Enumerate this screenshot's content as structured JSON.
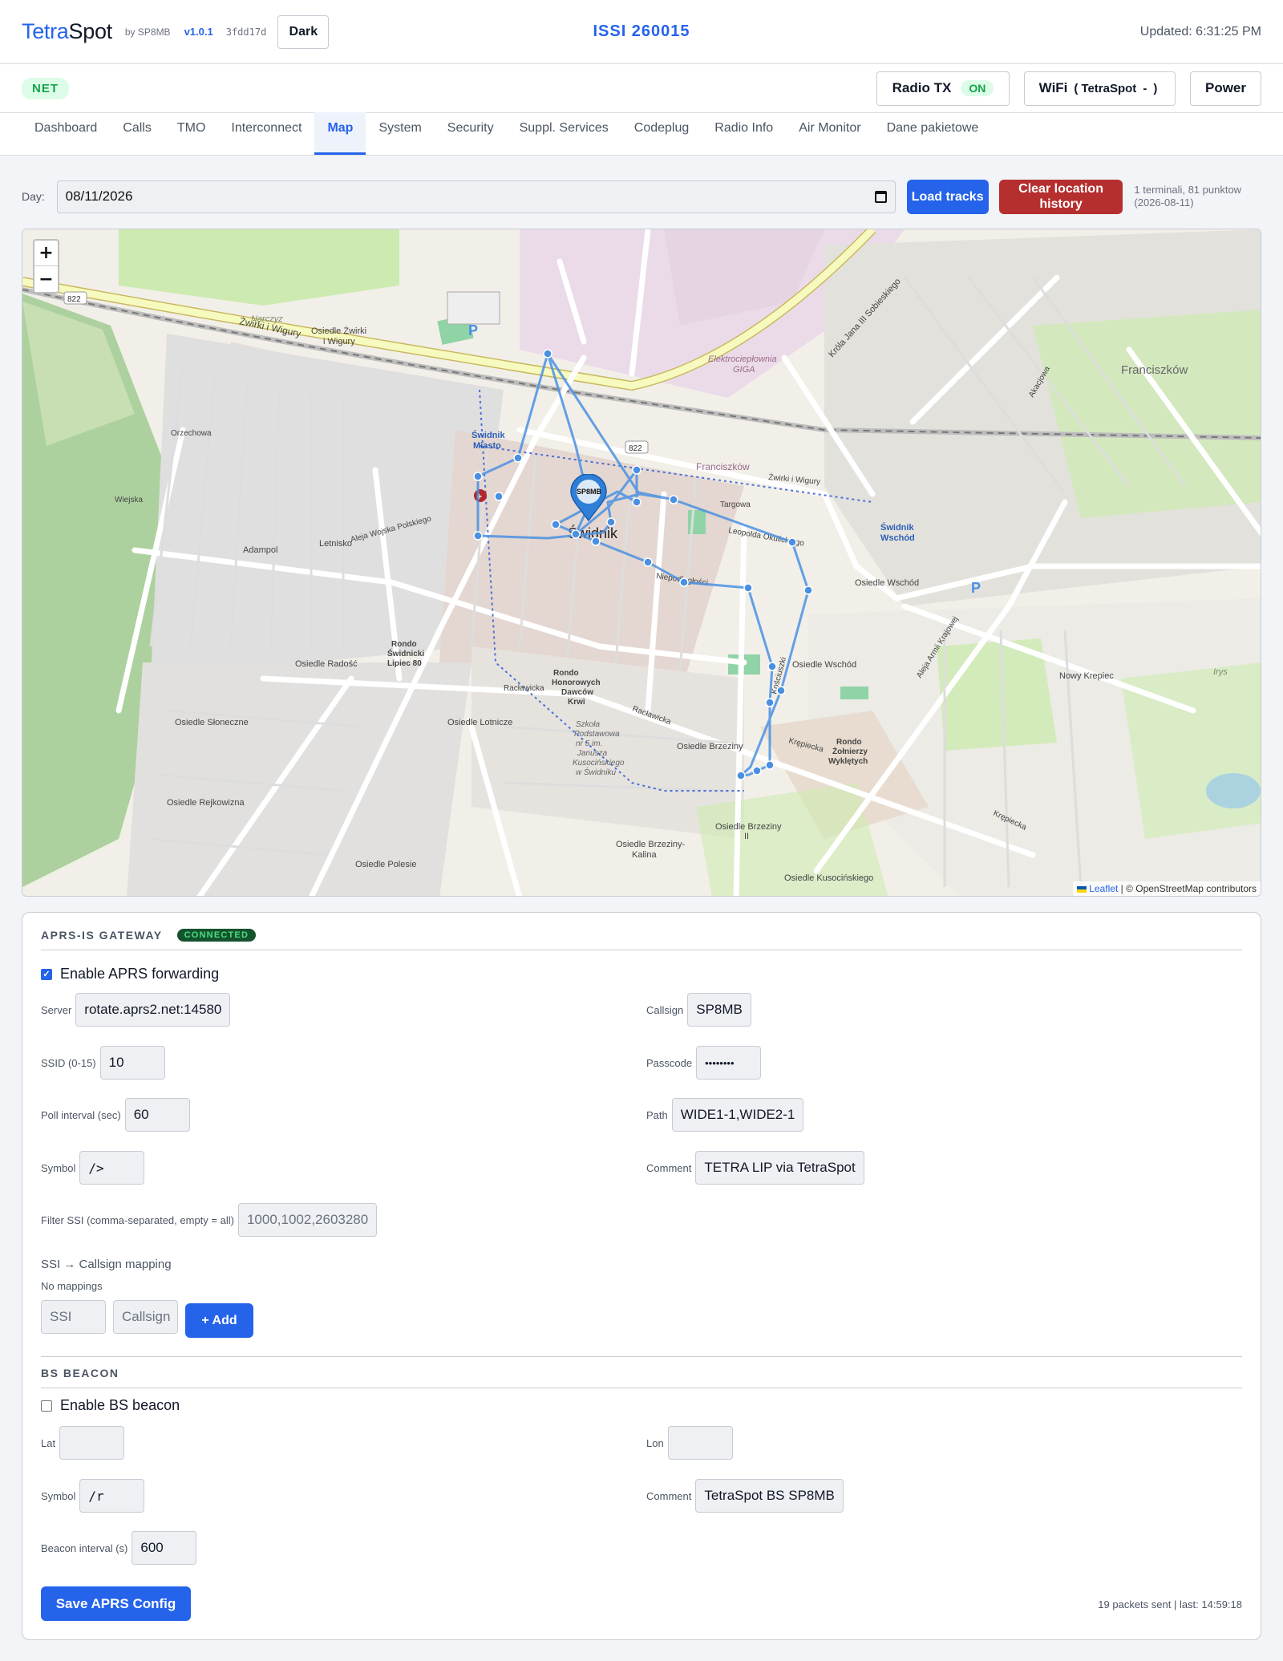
{
  "header": {
    "brand_part1": "Tetra",
    "brand_part2": "Spot",
    "by": "by SP8MB",
    "version": "v1.0.1",
    "hash": "3fdd17d",
    "dark_button": "Dark",
    "issi": "ISSI 260015",
    "updated": "Updated: 6:31:25 PM"
  },
  "status": {
    "net": "NET",
    "radio_tx_label": "Radio TX",
    "radio_tx_state": "ON",
    "wifi_label": "WiFi",
    "wifi_open": "(",
    "wifi_ssid": "TetraSpot",
    "wifi_dash": "-",
    "wifi_close": ")",
    "power": "Power"
  },
  "tabs": [
    {
      "label": "Dashboard"
    },
    {
      "label": "Calls"
    },
    {
      "label": "TMO"
    },
    {
      "label": "Interconnect"
    },
    {
      "label": "Map"
    },
    {
      "label": "System"
    },
    {
      "label": "Security"
    },
    {
      "label": "Suppl. Services"
    },
    {
      "label": "Codeplug"
    },
    {
      "label": "Radio Info"
    },
    {
      "label": "Air Monitor"
    },
    {
      "label": "Dane pakietowe"
    }
  ],
  "active_tab": "Map",
  "day": {
    "label": "Day:",
    "value": "08/11/2026",
    "load_button": "Load tracks",
    "clear_button": "Clear location history",
    "info": "1 terminali, 81 punktow (2026-08-11)"
  },
  "map": {
    "zoom_in": "+",
    "zoom_out": "−",
    "attribution_leaflet": "Leaflet",
    "attribution_osm": "| © OpenStreetMap contributors",
    "marker_label": "SP8MB",
    "places": {
      "franciszkow": "Franciszków",
      "franciszkow2": "Franciszków",
      "swidnik": "Świdnik",
      "swidnik_miasto": "Świdnik Miasto",
      "swidnik_wschod": "Świdnik Wschód",
      "adampol": "Adampol",
      "letnisko": "Letnisko",
      "narczyz": "Narczyz",
      "os_zwirki": "Osiedle Żwirki i Wigury",
      "os_radosc": "Osiedle Radość",
      "os_sloneczne": "Osiedle Słoneczne",
      "os_rejkowizna": "Osiedle Rejkowizna",
      "os_polesie": "Osiedle Polesie",
      "os_lotnicze": "Osiedle Lotnicze",
      "os_brzeziny": "Osiedle Brzeziny",
      "os_brzeziny2": "Osiedle Brzeziny II",
      "os_brzeziny_kalina": "Osiedle Brzeziny-Kalina",
      "os_wschod": "Osiedle Wschód",
      "os_wschod2": "Osiedle Wschód",
      "os_kusocinskiego": "Osiedle Kusocińskiego",
      "nowy_krepiec": "Nowy Krępiec",
      "rondo_lipiec": "Rondo Świdnicki Lipiec 80",
      "rondo_krwi": "Rondo Honorowych Dawców Krwi",
      "rondo_zolnierzy": "Rondo Żołnierzy Wyklętych",
      "elektrocieplownia": "Elektrociepłownia GIGA",
      "zwirki_wigury": "Żwirki i Wigury",
      "zwirki_wigury2": "Żwirki i Wigury",
      "krola_jana": "Króla Jana III Sobieskiego",
      "aleja_armii": "Aleja Armii Krajowej",
      "raclawicka": "Racławicka",
      "raclawicka2": "Racławicka",
      "krepiecka": "Krępiecka",
      "krepiecka2": "Krępiecka",
      "kosciuszki": "Kościuszki",
      "szkola": "Szkoła Podstawowa nr 5 im. Janusza Kusocińskiego w Świdniku",
      "road_822": "822",
      "road_822b": "822",
      "irys": "Irys",
      "parking": "P",
      "parking2": "P",
      "wyzwolenia": "Aleja Wojska Polskiego",
      "okulickiego": "Leopolda Okulickiego",
      "niepodleglosci": "Niepodległości",
      "targowa": "Targowa",
      "wiejska": "Wiejska",
      "orzechowa": "Orzechowa",
      "akacjowa": "Akacjowa",
      "zwirki_st": "Żwirki i Wigury"
    }
  },
  "aprs": {
    "title": "APRS-IS GATEWAY",
    "status": "CONNECTED",
    "enable_label": "Enable APRS forwarding",
    "enabled": true,
    "server_label": "Server",
    "server": "rotate.aprs2.net:14580",
    "callsign_label": "Callsign",
    "callsign": "SP8MB",
    "ssid_label": "SSID (0-15)",
    "ssid": "10",
    "passcode_label": "Passcode",
    "passcode": "••••••••",
    "poll_label": "Poll interval (sec)",
    "poll": "60",
    "path_label": "Path",
    "path": "WIDE1-1,WIDE2-1",
    "symbol_label": "Symbol",
    "symbol": "/>",
    "comment_label": "Comment",
    "comment": "TETRA LIP via TetraSpot",
    "filter_label": "Filter SSI (comma-separated, empty = all)",
    "filter_placeholder": "1000,1002,2603280",
    "mapping_title": "SSI → Callsign mapping",
    "no_mappings": "No mappings",
    "ssi_placeholder": "SSI",
    "callsign_placeholder": "Callsign",
    "add_button": "+ Add"
  },
  "beacon": {
    "title": "BS BEACON",
    "enable_label": "Enable BS beacon",
    "enabled": false,
    "lat_label": "Lat",
    "lat": "",
    "lon_label": "Lon",
    "lon": "",
    "symbol_label": "Symbol",
    "symbol": "/r",
    "comment_label": "Comment",
    "comment": "TetraSpot BS SP8MB",
    "interval_label": "Beacon interval (s)",
    "interval": "600",
    "save_button": "Save APRS Config",
    "packets_info": "19 packets sent | last: 14:59:18"
  },
  "colors": {
    "accent": "#2563eb",
    "danger": "#b62f2f",
    "success": "#16a34a",
    "track": "#4a90e2"
  }
}
